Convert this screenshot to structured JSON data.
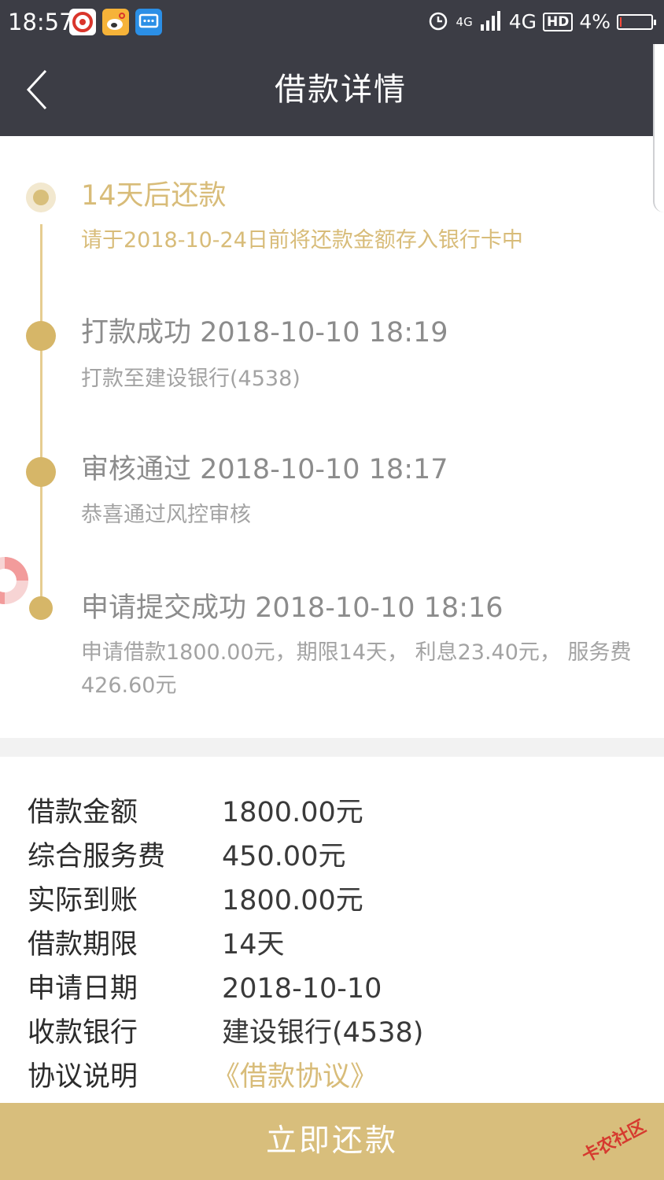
{
  "status_bar": {
    "time": "18:57",
    "signal_label": "4G",
    "network": "4G",
    "hd": "HD",
    "battery": "4%",
    "battery_level": 0.04,
    "icons": [
      "netease-news-icon",
      "weibo-icon",
      "message-icon",
      "alarm-icon",
      "signal-icon",
      "battery-icon"
    ]
  },
  "nav": {
    "title": "借款详情",
    "back_icon": "chevron-left-icon"
  },
  "timeline": [
    {
      "title": "14天后还款",
      "desc": "请于2018-10-24日前将还款金额存入银行卡中"
    },
    {
      "title": "打款成功 2018-10-10 18:19",
      "desc": "打款至建设银行(4538)"
    },
    {
      "title": "审核通过 2018-10-10 18:17",
      "desc": "恭喜通过风控审核"
    },
    {
      "title": "申请提交成功 2018-10-10 18:16",
      "desc": "申请借款1800.00元，期限14天， 利息23.40元， 服务费426.60元"
    }
  ],
  "details": [
    {
      "label": "借款金额",
      "value": "1800.00元"
    },
    {
      "label": "综合服务费",
      "value": "450.00元"
    },
    {
      "label": "实际到账",
      "value": "1800.00元"
    },
    {
      "label": "借款期限",
      "value": "14天"
    },
    {
      "label": "申请日期",
      "value": "2018-10-10"
    },
    {
      "label": "收款银行",
      "value": "建设银行(4538)"
    },
    {
      "label": "协议说明",
      "value": "《借款协议》"
    }
  ],
  "repay_button": "立即还款",
  "watermark": "卡农社区",
  "colors": {
    "header_bg": "#3c3d45",
    "accent_gold": "#d8bc79",
    "button_bg": "#d8be7c",
    "text_gray": "#8c8c8c"
  }
}
